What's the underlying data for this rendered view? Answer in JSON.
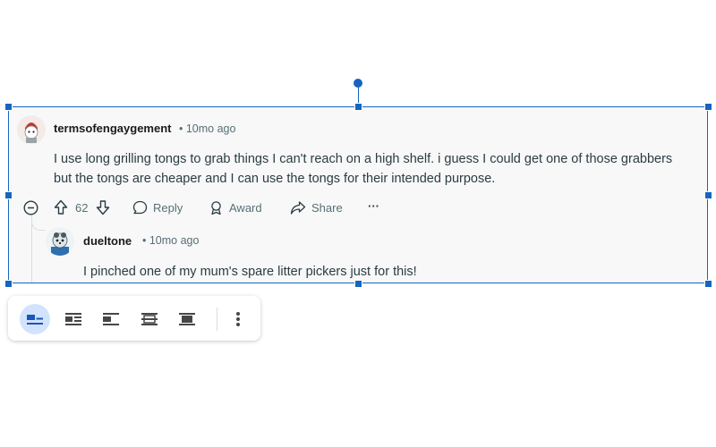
{
  "comment": {
    "username": "termsofengaygement",
    "time": "• 10mo ago",
    "body_line1": "I use long grilling tongs to grab things I can't reach on a high shelf. i guess I could get one of those grabbers",
    "body_line2": "but the tongs are cheaper and I can use the tongs for their intended purpose.",
    "votes": "62",
    "reply_label": "Reply",
    "award_label": "Award",
    "share_label": "Share",
    "more_label": "···"
  },
  "reply": {
    "username": "dueltone",
    "time": "• 10mo ago",
    "body": "I pinched one of my mum's spare litter pickers just for this!"
  },
  "toolbar": {
    "buttons": [
      "wrap-inline",
      "wrap-text",
      "break-text",
      "behind-text",
      "in-front-of-text",
      "more-options"
    ],
    "active": "wrap-inline"
  },
  "colors": {
    "selection": "#1565c0",
    "active_button_bg": "#d3e3fd",
    "meta_text": "#576f76"
  }
}
